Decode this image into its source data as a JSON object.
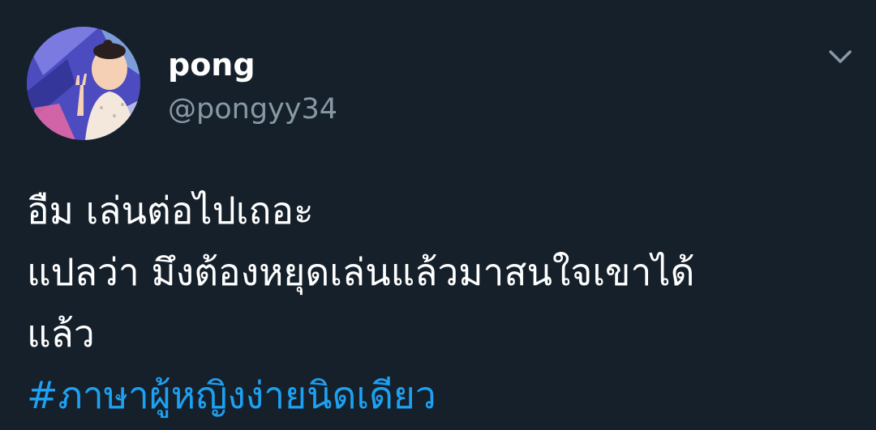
{
  "tweet": {
    "display_name": "pong",
    "handle": "@pongyy34",
    "lines": [
      "อืม เล่นต่อไปเถอะ",
      "แปลว่า มึงต้องหยุดเล่นแล้วมาสนใจเขาได้",
      "แล้ว"
    ],
    "hashtag": "#ภาษาผู้หญิงง่ายนิดเดียว"
  },
  "icons": {
    "menu": "chevron-down-icon"
  },
  "colors": {
    "background": "#15202b",
    "text": "#ffffff",
    "secondary_text": "#8899a6",
    "link": "#1da1f2"
  }
}
